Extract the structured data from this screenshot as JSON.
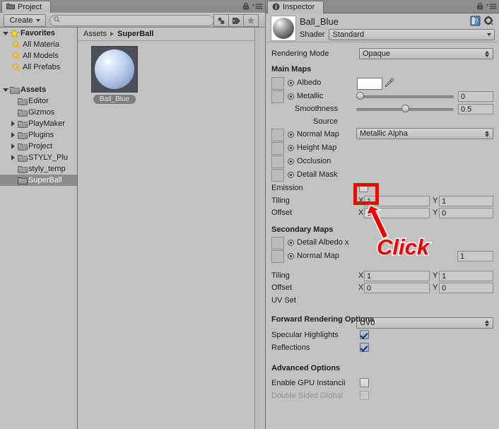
{
  "project": {
    "tab_label": "Project",
    "tab_icon": "folder-icon",
    "lock_icon": "lock-icon",
    "menu_icon": "hamburger-menu-icon",
    "create_label": "Create",
    "search": {
      "value": "",
      "placeholder": "",
      "icon": "search-icon"
    },
    "toolbar_icons": [
      "filter-shapes-icon",
      "label-tag-icon",
      "favorite-star-icon"
    ],
    "tree": [
      {
        "label": "Favorites",
        "icon": "star-icon",
        "arrow": "down",
        "bold": true,
        "indent": 0,
        "selected": false
      },
      {
        "label": "All Materia",
        "icon": "search-icon",
        "arrow": "none",
        "bold": false,
        "indent": 1,
        "selected": false
      },
      {
        "label": "All Models",
        "icon": "search-icon",
        "arrow": "none",
        "bold": false,
        "indent": 1,
        "selected": false
      },
      {
        "label": "All Prefabs",
        "icon": "search-icon",
        "arrow": "none",
        "bold": false,
        "indent": 1,
        "selected": false
      },
      {
        "label": "",
        "icon": "none",
        "arrow": "none",
        "bold": false,
        "indent": 0,
        "selected": false
      },
      {
        "label": "Assets",
        "icon": "folder-icon",
        "arrow": "down",
        "bold": true,
        "indent": 0,
        "selected": false
      },
      {
        "label": "Editor",
        "icon": "folder-icon",
        "arrow": "none",
        "bold": false,
        "indent": 1,
        "selected": false
      },
      {
        "label": "Gizmos",
        "icon": "folder-icon",
        "arrow": "none",
        "bold": false,
        "indent": 1,
        "selected": false
      },
      {
        "label": "PlayMaker",
        "icon": "folder-icon",
        "arrow": "right",
        "bold": false,
        "indent": 1,
        "selected": false
      },
      {
        "label": "Plugins",
        "icon": "folder-icon",
        "arrow": "right",
        "bold": false,
        "indent": 1,
        "selected": false
      },
      {
        "label": "Project",
        "icon": "folder-icon",
        "arrow": "right",
        "bold": false,
        "indent": 1,
        "selected": false
      },
      {
        "label": "STYLY_Plu",
        "icon": "folder-icon",
        "arrow": "right",
        "bold": false,
        "indent": 1,
        "selected": false
      },
      {
        "label": "styly_temp",
        "icon": "folder-icon",
        "arrow": "none",
        "bold": false,
        "indent": 1,
        "selected": false
      },
      {
        "label": "SuperBall",
        "icon": "folder-icon",
        "arrow": "none",
        "bold": false,
        "indent": 1,
        "selected": true
      }
    ],
    "breadcrumb": {
      "root": "Assets",
      "current": "SuperBall"
    },
    "assets": [
      {
        "name": "Ball_Blue",
        "thumb": "blue-sphere-material-icon"
      }
    ]
  },
  "inspector": {
    "tab_label": "Inspector",
    "tab_icon": "info-icon",
    "lock_icon": "lock-icon",
    "menu_icon": "hamburger-menu-icon",
    "help_icon": "help-book-icon",
    "settings_icon": "gear-icon",
    "material_name": "Ball_Blue",
    "material_preview_icon": "sphere-preview-icon",
    "shader": {
      "label": "Shader",
      "value": "Standard"
    },
    "rendering_mode": {
      "label": "Rendering Mode",
      "value": "Opaque"
    },
    "main_maps": {
      "title": "Main Maps",
      "albedo": {
        "label": "Albedo",
        "color": "#ffffff",
        "eyedropper_icon": "eyedropper-icon"
      },
      "metallic": {
        "label": "Metallic",
        "value": "0",
        "slider_pct": 0
      },
      "smoothness": {
        "label": "Smoothness",
        "value": "0.5",
        "slider_pct": 50
      },
      "source": {
        "label": "Source",
        "value": "Metallic Alpha"
      },
      "normal_map": {
        "label": "Normal Map"
      },
      "height_map": {
        "label": "Height Map"
      },
      "occlusion": {
        "label": "Occlusion"
      },
      "detail_mask": {
        "label": "Detail Mask"
      },
      "emission": {
        "label": "Emission",
        "checked": false
      },
      "tiling": {
        "label": "Tiling",
        "x_label": "X",
        "x": "1",
        "y_label": "Y",
        "y": "1"
      },
      "offset": {
        "label": "Offset",
        "x_label": "X",
        "x": "0",
        "y_label": "Y",
        "y": "0"
      }
    },
    "secondary_maps": {
      "title": "Secondary Maps",
      "detail_albedo": {
        "label": "Detail Albedo x"
      },
      "normal_map": {
        "label": "Normal Map",
        "value": "1"
      },
      "tiling": {
        "label": "Tiling",
        "x_label": "X",
        "x": "1",
        "y_label": "Y",
        "y": "1"
      },
      "offset": {
        "label": "Offset",
        "x_label": "X",
        "x": "0",
        "y_label": "Y",
        "y": "0"
      },
      "uv_set": {
        "label": "UV Set",
        "value": "UV0"
      }
    },
    "forward_rendering": {
      "title": "Forward Rendering Options",
      "specular_highlights": {
        "label": "Specular Highlights",
        "checked": true
      },
      "reflections": {
        "label": "Reflections",
        "checked": true
      }
    },
    "advanced": {
      "title": "Advanced Options",
      "gpu_instancing": {
        "label": "Enable GPU Instancii",
        "checked": false
      },
      "double_sided": {
        "label": "Double Sided Global",
        "checked": false,
        "disabled": true
      }
    }
  },
  "annotation": {
    "click_label": "Click",
    "highlight_color": "#ff0000",
    "arrow_icon": "red-arrow-icon",
    "target": "emission-checkbox"
  }
}
